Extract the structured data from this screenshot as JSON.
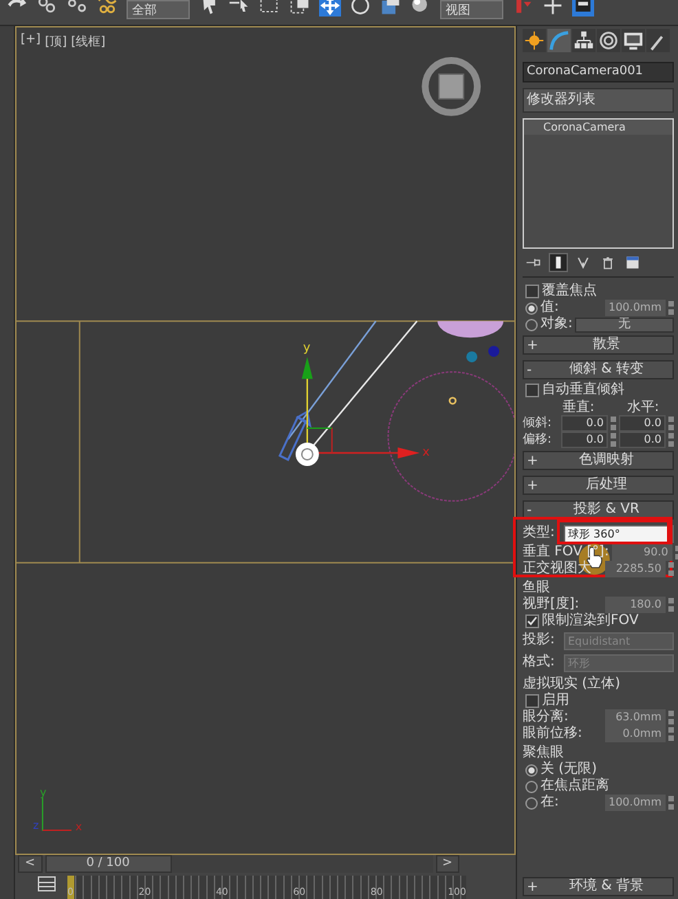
{
  "toolbar": [
    {
      "kind": "redo",
      "selected": false
    },
    {
      "kind": "link",
      "selected": false
    },
    {
      "kind": "unlink",
      "selected": false
    },
    {
      "kind": "bind",
      "selected": false
    },
    {
      "kind": "dropdown",
      "value": "全部"
    },
    {
      "kind": "select",
      "selected": false
    },
    {
      "kind": "select-by-name",
      "selected": false
    },
    {
      "kind": "region",
      "selected": false
    },
    {
      "kind": "crossing",
      "selected": false
    },
    {
      "kind": "move",
      "selected": true
    },
    {
      "kind": "rotate",
      "selected": false
    },
    {
      "kind": "scale",
      "selected": false
    },
    {
      "kind": "sphere",
      "selected": false
    },
    {
      "kind": "dropdown",
      "value": "视图"
    },
    {
      "kind": "pivot",
      "selected": false
    },
    {
      "kind": "snap",
      "selected": false
    },
    {
      "kind": "keyboard",
      "selected": true
    }
  ],
  "viewport": {
    "labels": [
      "[+]",
      "[顶]",
      "[线框]"
    ],
    "active": true,
    "gizmo": {
      "x": "x",
      "y": "y"
    },
    "tripod": {
      "x": "x",
      "y": "y",
      "z": "z"
    }
  },
  "timeline": {
    "prev": "<",
    "slider": {
      "frame": "0 / 100",
      "level": 0
    },
    "next": ">",
    "ticks": [
      "0",
      "20",
      "40",
      "60",
      "80",
      "100"
    ],
    "level": 0
  },
  "panel": {
    "tabs": [
      {
        "kind": "create",
        "selected": false
      },
      {
        "kind": "modify",
        "selected": true
      },
      {
        "kind": "hierarchy",
        "selected": false
      },
      {
        "kind": "motion",
        "selected": false
      },
      {
        "kind": "display",
        "selected": false
      },
      {
        "kind": "utilities",
        "selected": false
      }
    ],
    "object_name": "CoronaCamera001",
    "modifier_list": "修改器列表",
    "stack": [
      "CoronaCamera"
    ],
    "stack_tools": [
      {
        "kind": "pin",
        "selected": false
      },
      {
        "kind": "end-result",
        "selected": true
      },
      {
        "kind": "unique",
        "selected": false
      },
      {
        "kind": "remove",
        "selected": false
      },
      {
        "kind": "configure",
        "selected": false
      }
    ],
    "rows": [
      {
        "kind": "checkbox",
        "label": "覆盖焦点",
        "checked": false
      },
      {
        "kind": "radio-field",
        "label": "值:",
        "selected": true,
        "value": "100.0mm"
      },
      {
        "kind": "radio-button",
        "label": "对象:",
        "selected": false,
        "button": "无"
      },
      {
        "kind": "rollout",
        "sign": "+",
        "title": "散景"
      },
      {
        "kind": "rollout",
        "sign": "-",
        "title": "倾斜 & 转变"
      },
      {
        "kind": "checkbox",
        "label": "自动垂直倾斜",
        "checked": false
      },
      {
        "kind": "pair-header",
        "col1": "垂直:",
        "col2": "水平:"
      },
      {
        "kind": "pair-row",
        "label": "倾斜:",
        "v1": "0.0",
        "v2": "0.0"
      },
      {
        "kind": "pair-row",
        "label": "偏移:",
        "v1": "0.0",
        "v2": "0.0"
      },
      {
        "kind": "rollout",
        "sign": "+",
        "title": "色调映射"
      },
      {
        "kind": "rollout",
        "sign": "+",
        "title": "后处理"
      },
      {
        "kind": "rollout",
        "sign": "-",
        "title": "投影 & VR"
      },
      {
        "kind": "dropdown-row",
        "label": "类型:",
        "value": "球形 360°",
        "disabled": false,
        "highlighted": true
      },
      {
        "kind": "field-row",
        "label": "垂直 FOV [°]:",
        "value": "90.0",
        "disabled": true
      },
      {
        "kind": "field-row",
        "label": "正交视图大",
        "value": "2285.50",
        "disabled": true
      },
      {
        "kind": "group-title",
        "label": "鱼眼"
      },
      {
        "kind": "field-row",
        "label": "视野[度]:",
        "value": "180.0",
        "disabled": true
      },
      {
        "kind": "checkbox",
        "label": "限制渲染到FOV",
        "checked": true
      },
      {
        "kind": "dropdown-row",
        "label": "投影:",
        "value": "Equidistant",
        "disabled": true,
        "highlighted": false
      },
      {
        "kind": "dropdown-row",
        "label": "格式:",
        "value": "环形",
        "disabled": true,
        "highlighted": false
      },
      {
        "kind": "group-title",
        "label": "虚拟现实 (立体)"
      },
      {
        "kind": "checkbox",
        "label": "启用",
        "checked": false
      },
      {
        "kind": "field-row",
        "label": "眼分离:",
        "value": "63.0mm",
        "disabled": true
      },
      {
        "kind": "field-row",
        "label": "眼前位移:",
        "value": "0.0mm",
        "disabled": true
      },
      {
        "kind": "group-title",
        "label": "聚焦眼"
      },
      {
        "kind": "radio",
        "label": "关 (无限)",
        "selected": true
      },
      {
        "kind": "radio",
        "label": "在焦点距离",
        "selected": false
      },
      {
        "kind": "radio-field",
        "label": "在:",
        "selected": false,
        "value": "100.0mm"
      },
      {
        "kind": "rollout",
        "sign": "+",
        "title": "环境 & 背景"
      }
    ]
  }
}
